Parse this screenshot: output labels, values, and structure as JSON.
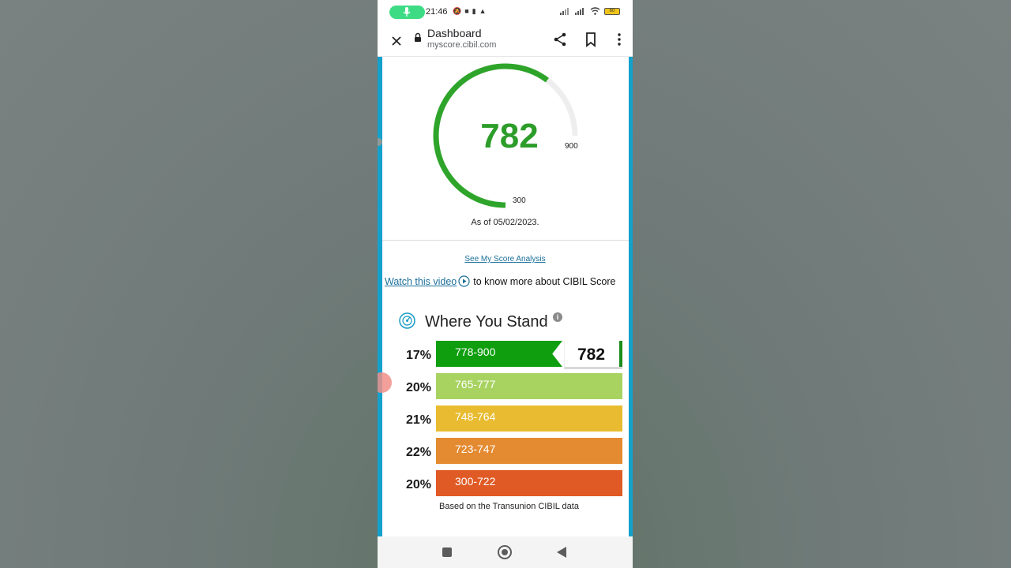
{
  "status_bar": {
    "time": "21:46",
    "battery": "60"
  },
  "browser": {
    "title": "Dashboard",
    "url": "myscore.cibil.com"
  },
  "gauge": {
    "score": "782",
    "min_label": "300",
    "max_label": "900",
    "min": 300,
    "max": 900,
    "value": 782,
    "as_of": "As of 05/02/2023.",
    "fill_color": "#2ea52a",
    "track_color": "#eeeeee"
  },
  "links": {
    "score_analysis": "See My Score Analysis",
    "watch_video": "Watch this video",
    "video_suffix": "to know more about CIBIL Score"
  },
  "where_you_stand": {
    "title": "Where You Stand",
    "info_glyph": "i",
    "user_score": "782",
    "bands": [
      {
        "pct": "17%",
        "range": "778-900",
        "color": "#0e9e0e",
        "active": true
      },
      {
        "pct": "20%",
        "range": "765-777",
        "color": "#a8d361",
        "active": false
      },
      {
        "pct": "21%",
        "range": "748-764",
        "color": "#e8bb30",
        "active": false
      },
      {
        "pct": "22%",
        "range": "723-747",
        "color": "#e48a30",
        "active": false
      },
      {
        "pct": "20%",
        "range": "300-722",
        "color": "#e05a25",
        "active": false
      }
    ],
    "footer": "Based on the Transunion CIBIL data"
  }
}
